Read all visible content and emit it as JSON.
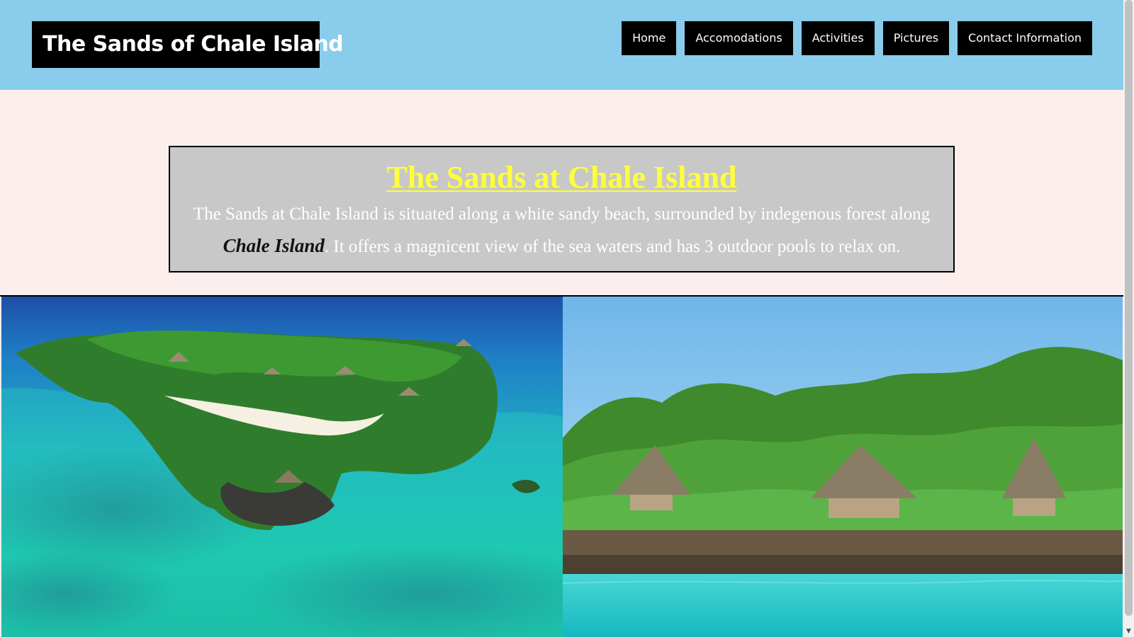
{
  "site": {
    "brand": "The Sands of Chale Island"
  },
  "nav": {
    "items": [
      {
        "label": "Home"
      },
      {
        "label": "Accomodations"
      },
      {
        "label": "Activities"
      },
      {
        "label": "Pictures"
      },
      {
        "label": "Contact Information"
      }
    ]
  },
  "intro": {
    "title": "The Sands at Chale Island",
    "text_before": "The Sands at Chale Island is situated along a white sandy beach, surrounded by indegenous forest along",
    "emphasis": "Chale Island",
    "text_after": ". It offers a magnicent view of the sea waters and has 3 outdoor pools to relax on."
  },
  "photos": {
    "left": "aerial-island-photo",
    "right": "thatched-cottages-photo"
  },
  "scrollbar": {
    "down_arrow": "▼"
  },
  "colors": {
    "header_bg": "#89ccec",
    "page_bg": "#fdeeee",
    "intro_bg": "#c8c8c8",
    "title_color": "#ffff3a"
  }
}
